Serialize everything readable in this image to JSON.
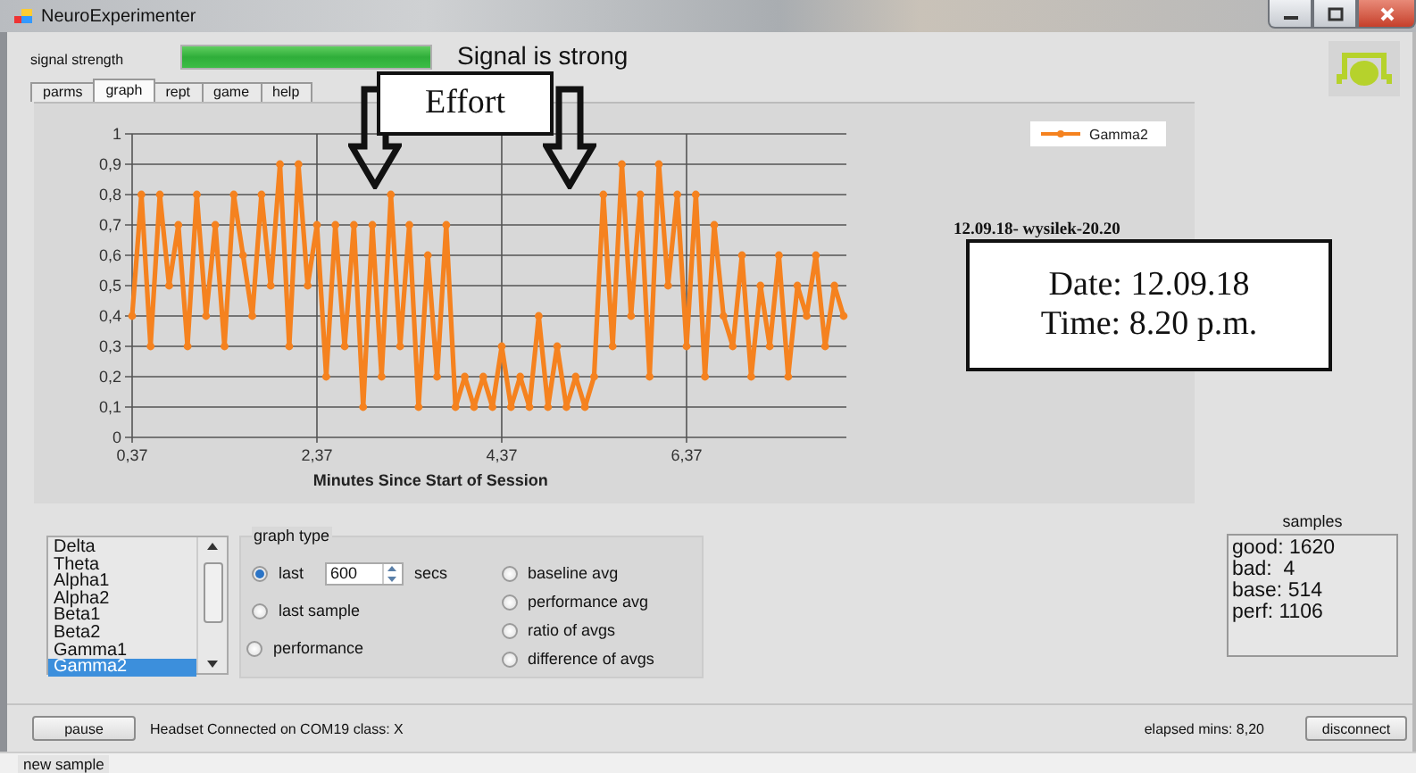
{
  "window": {
    "title": "NeuroExperimenter"
  },
  "signal": {
    "label": "signal strength",
    "level": 1.0,
    "status": "Signal is strong"
  },
  "tabs": [
    {
      "label": "parms",
      "selected": false
    },
    {
      "label": "graph",
      "selected": true
    },
    {
      "label": "rept",
      "selected": false
    },
    {
      "label": "game",
      "selected": false
    },
    {
      "label": "help",
      "selected": false
    }
  ],
  "chart": {
    "caption": "12.09.18- wysilek-20.20",
    "chart_data": {
      "type": "line",
      "grid": true,
      "xlabel": "Minutes Since Start of Session",
      "xlim": [
        0.37,
        8.1
      ],
      "ylim": [
        0,
        1
      ],
      "x": [
        0.37,
        0.47,
        0.57,
        0.67,
        0.77,
        0.87,
        0.97,
        1.07,
        1.17,
        1.27,
        1.37,
        1.47,
        1.57,
        1.67,
        1.77,
        1.87,
        1.97,
        2.07,
        2.17,
        2.27,
        2.37,
        2.47,
        2.57,
        2.67,
        2.77,
        2.87,
        2.97,
        3.07,
        3.17,
        3.27,
        3.37,
        3.47,
        3.57,
        3.67,
        3.77,
        3.87,
        3.97,
        4.07,
        4.17,
        4.27,
        4.37,
        4.47,
        4.57,
        4.67,
        4.77,
        4.87,
        4.97,
        5.07,
        5.17,
        5.27,
        5.37,
        5.47,
        5.57,
        5.67,
        5.77,
        5.87,
        5.97,
        6.07,
        6.17,
        6.27,
        6.37,
        6.47,
        6.57,
        6.67,
        6.77,
        6.87,
        6.97,
        7.07,
        7.17,
        7.27,
        7.37,
        7.47,
        7.57,
        7.67,
        7.77,
        7.87,
        7.97,
        8.07
      ],
      "series": [
        {
          "name": "Gamma2",
          "color": "#f5821f",
          "marker": "circle",
          "values": [
            0.4,
            0.8,
            0.3,
            0.8,
            0.5,
            0.7,
            0.3,
            0.8,
            0.4,
            0.7,
            0.3,
            0.8,
            0.6,
            0.4,
            0.8,
            0.5,
            0.9,
            0.3,
            0.9,
            0.5,
            0.7,
            0.2,
            0.7,
            0.3,
            0.7,
            0.1,
            0.7,
            0.2,
            0.8,
            0.3,
            0.7,
            0.1,
            0.6,
            0.2,
            0.7,
            0.1,
            0.2,
            0.1,
            0.2,
            0.1,
            0.3,
            0.1,
            0.2,
            0.1,
            0.4,
            0.1,
            0.3,
            0.1,
            0.2,
            0.1,
            0.2,
            0.8,
            0.3,
            0.9,
            0.4,
            0.8,
            0.2,
            0.9,
            0.5,
            0.8,
            0.3,
            0.8,
            0.2,
            0.7,
            0.4,
            0.3,
            0.6,
            0.2,
            0.5,
            0.3,
            0.6,
            0.2,
            0.5,
            0.4,
            0.6,
            0.3,
            0.5,
            0.4
          ]
        }
      ],
      "xticks": [
        {
          "value": 0.37,
          "label": "0,37"
        },
        {
          "value": 2.37,
          "label": "2,37"
        },
        {
          "value": 4.37,
          "label": "4,37"
        },
        {
          "value": 6.37,
          "label": "6,37"
        }
      ],
      "yticks": [
        {
          "value": 1,
          "label": "1"
        },
        {
          "value": 0.9,
          "label": "0,9"
        },
        {
          "value": 0.8,
          "label": "0,8"
        },
        {
          "value": 0.7,
          "label": "0,7"
        },
        {
          "value": 0.6,
          "label": "0,6"
        },
        {
          "value": 0.5,
          "label": "0,5"
        },
        {
          "value": 0.4,
          "label": "0,4"
        },
        {
          "value": 0.3,
          "label": "0,3"
        },
        {
          "value": 0.2,
          "label": "0,2"
        },
        {
          "value": 0.1,
          "label": "0,1"
        },
        {
          "value": 0,
          "label": "0"
        }
      ]
    }
  },
  "annotations": [
    {
      "kind": "arrows",
      "text": "Effort"
    },
    {
      "kind": "box",
      "lines": [
        "Date: 12.09.18",
        "Time: 8.20 p.m."
      ]
    }
  ],
  "bands": [
    {
      "label": "Delta",
      "selected": false
    },
    {
      "label": "Theta",
      "selected": false
    },
    {
      "label": "Alpha1",
      "selected": false
    },
    {
      "label": "Alpha2",
      "selected": false
    },
    {
      "label": "Beta1",
      "selected": false
    },
    {
      "label": "Beta2",
      "selected": false
    },
    {
      "label": "Gamma1",
      "selected": false
    },
    {
      "label": "Gamma2",
      "selected": true
    }
  ],
  "graph_type": {
    "title": "graph type",
    "columns": [
      [
        {
          "kind": "spin",
          "label": "last",
          "selected": true,
          "value": "600",
          "unit": "secs"
        },
        {
          "kind": "plain",
          "label": "last sample",
          "selected": false
        },
        {
          "kind": "plain",
          "label": "performance",
          "selected": false
        }
      ],
      [
        {
          "kind": "plain",
          "label": "baseline avg",
          "selected": false
        },
        {
          "kind": "plain",
          "label": "performance avg",
          "selected": false
        },
        {
          "kind": "plain",
          "label": "ratio of avgs",
          "selected": false
        },
        {
          "kind": "plain",
          "label": "difference of avgs",
          "selected": false
        }
      ]
    ]
  },
  "samples": {
    "title": "samples",
    "lines": [
      "good: 1620",
      "bad:  4",
      "base: 514",
      "perf: 1106"
    ]
  },
  "footer": {
    "pause": "pause",
    "connection": "Headset Connected on COM19 class:  X",
    "elapsed": "elapsed mins: 8,20",
    "disconnect": "disconnect"
  },
  "status_bar": "new sample"
}
